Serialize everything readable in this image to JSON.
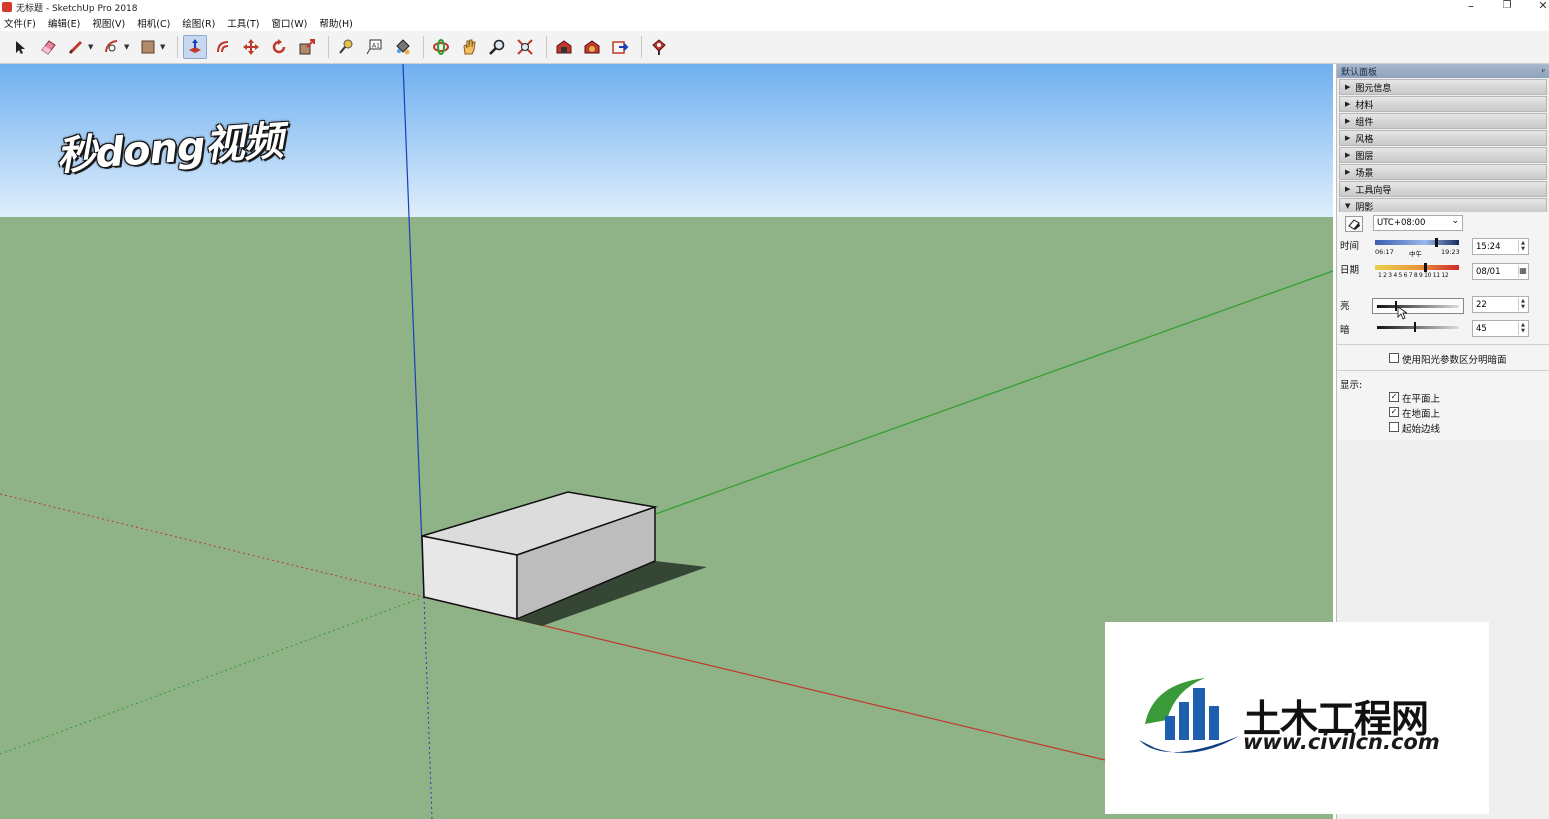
{
  "window": {
    "title": "无标题 - SketchUp Pro 2018",
    "minimize_glyph": "–",
    "restore_glyph": "❐",
    "close_glyph": "✕"
  },
  "menu": [
    "文件(F)",
    "编辑(E)",
    "视图(V)",
    "相机(C)",
    "绘图(R)",
    "工具(T)",
    "窗口(W)",
    "帮助(H)"
  ],
  "toolbar": {
    "tools": [
      "select-tool",
      "eraser-tool",
      "line-tool",
      "arc-tool",
      "rectangle-tool",
      "push-pull-tool",
      "offset-tool",
      "move-tool",
      "rotate-tool",
      "scale-tool",
      "tape-measure-tool",
      "text-tool",
      "paint-bucket-tool",
      "orbit-tool",
      "pan-tool",
      "zoom-tool",
      "zoom-extents-tool",
      "warehouse-tool",
      "extension-warehouse-tool",
      "send-to-layout-tool",
      "extension-manager-tool"
    ],
    "active_tool": "push-pull-tool"
  },
  "watermark": {
    "top_left": "秒dong视频",
    "logo_cn": "土木工程网",
    "logo_url": "www.civilcn.com",
    "logo_colors": [
      "#1e5fb0",
      "#3a9a3a",
      "#0f3f86"
    ]
  },
  "scene": {
    "sky_color_top": "#6fb0f0",
    "sky_color_bottom": "#dfeefc",
    "ground_color": "#8fb387",
    "axis_red": "#c0392b",
    "axis_green": "#2e9e2e",
    "axis_blue": "#1a3fb8"
  },
  "panel": {
    "title": "默认面板",
    "pin_glyph": "ᵖ",
    "trays": [
      {
        "label": "图元信息",
        "expanded": false
      },
      {
        "label": "材料",
        "expanded": false
      },
      {
        "label": "组件",
        "expanded": false
      },
      {
        "label": "风格",
        "expanded": false
      },
      {
        "label": "图层",
        "expanded": false
      },
      {
        "label": "场景",
        "expanded": false
      },
      {
        "label": "工具向导",
        "expanded": false
      },
      {
        "label": "阴影",
        "expanded": true
      }
    ],
    "shadows": {
      "timezone": "UTC+08:00",
      "time_label": "时间",
      "time_start": "06:17",
      "time_noon": "中午",
      "time_end": "19:23",
      "time_value": "15:24",
      "time_fraction": 0.72,
      "date_label": "日期",
      "date_months": "1 2 3 4 5 6 7 8 9 10 11 12",
      "date_value": "08/01",
      "date_fraction": 0.58,
      "light_label": "亮",
      "light_value": "22",
      "light_fraction": 0.22,
      "dark_label": "暗",
      "dark_value": "45",
      "dark_fraction": 0.45,
      "use_sun_label": "使用阳光参数区分明暗面",
      "use_sun_checked": false,
      "display_label": "显示:",
      "on_faces_label": "在平面上",
      "on_faces_checked": true,
      "on_ground_label": "在地面上",
      "on_ground_checked": true,
      "from_edges_label": "起始边线",
      "from_edges_checked": false,
      "check_glyph": "✓",
      "dropdown_glyph": "⌄",
      "spin_up_glyph": "▲",
      "spin_down_glyph": "▼"
    }
  }
}
